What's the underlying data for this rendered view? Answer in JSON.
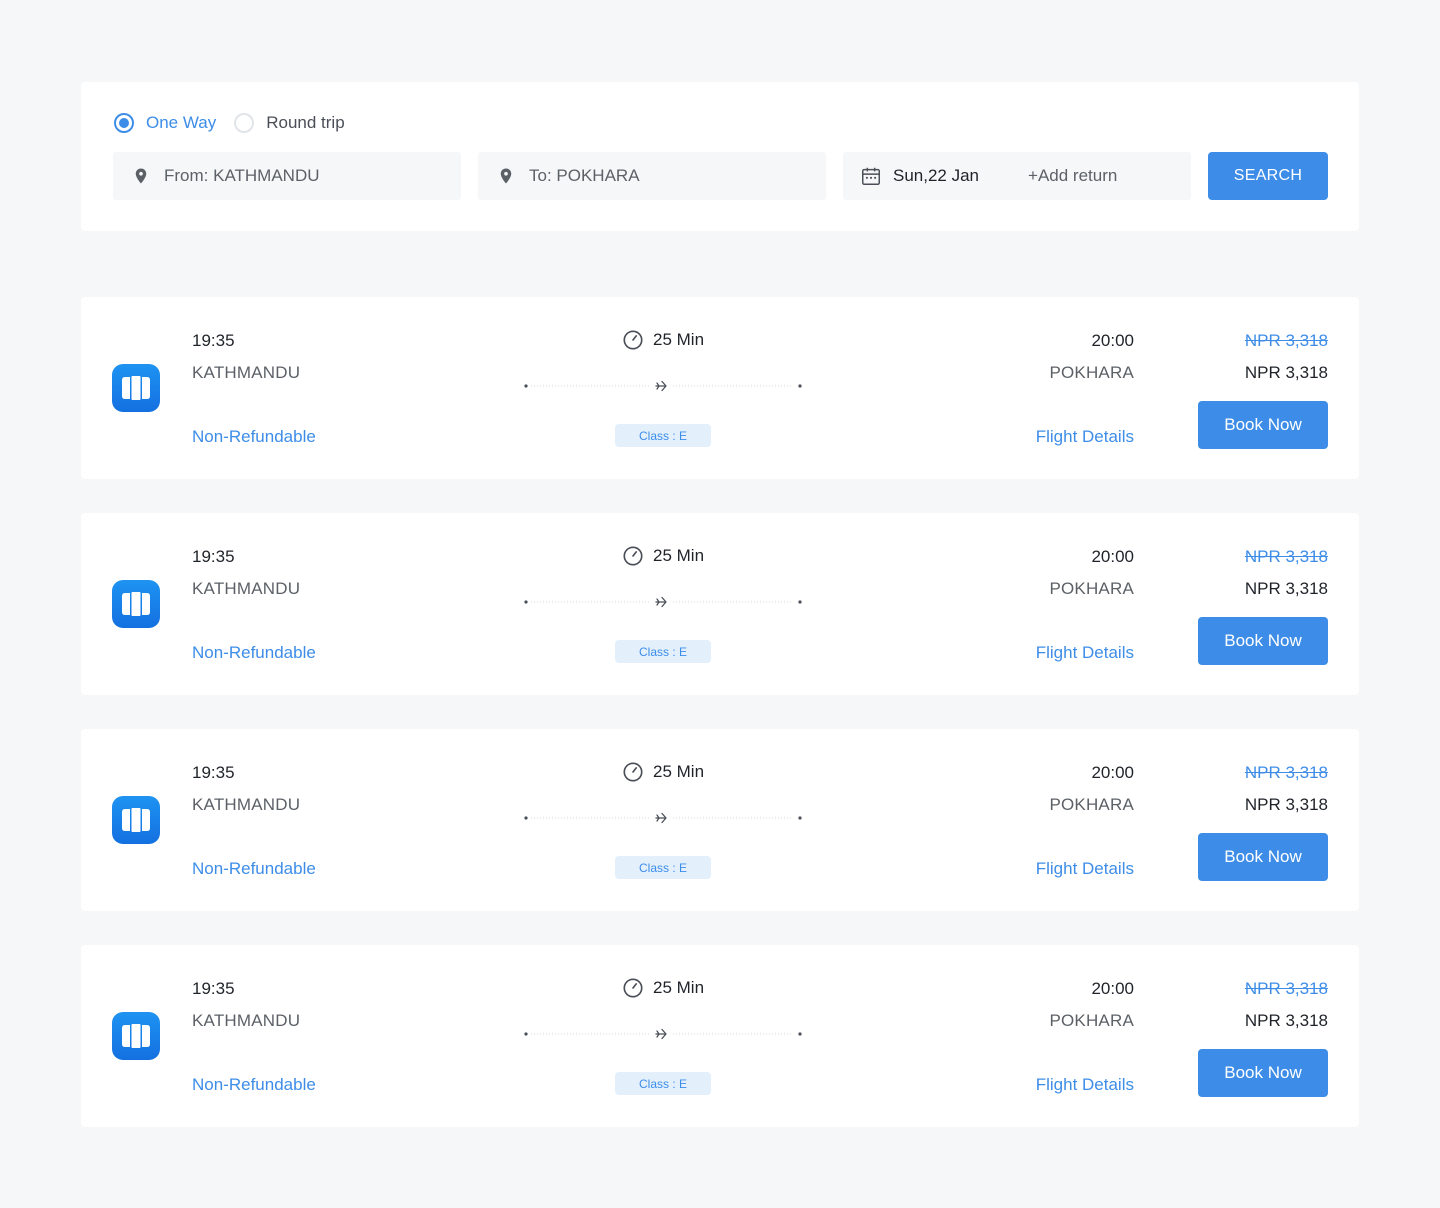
{
  "search": {
    "trip_types": [
      {
        "label": "One Way",
        "selected": true
      },
      {
        "label": "Round trip",
        "selected": false
      }
    ],
    "from": "From: KATHMANDU",
    "to": "To: POKHARA",
    "date": "Sun,22 Jan",
    "add_return": "+Add return",
    "search_label": "SEARCH"
  },
  "flights": [
    {
      "airline_icon": "airline-logo-icon",
      "departure_time": "19:35",
      "departure_city": "KATHMANDU",
      "refund_policy": "Non-Refundable",
      "duration": "25 Min",
      "class_label": "Class : E",
      "arrival_time": "20:00",
      "arrival_city": "POKHARA",
      "details_label": "Flight Details",
      "original_price": "NPR 3,318",
      "price": "NPR 3,318",
      "book_label": "Book Now"
    },
    {
      "airline_icon": "airline-logo-icon",
      "departure_time": "19:35",
      "departure_city": "KATHMANDU",
      "refund_policy": "Non-Refundable",
      "duration": "25 Min",
      "class_label": "Class : E",
      "arrival_time": "20:00",
      "arrival_city": "POKHARA",
      "details_label": "Flight Details",
      "original_price": "NPR 3,318",
      "price": "NPR 3,318",
      "book_label": "Book Now"
    },
    {
      "airline_icon": "airline-logo-icon",
      "departure_time": "19:35",
      "departure_city": "KATHMANDU",
      "refund_policy": "Non-Refundable",
      "duration": "25 Min",
      "class_label": "Class : E",
      "arrival_time": "20:00",
      "arrival_city": "POKHARA",
      "details_label": "Flight Details",
      "original_price": "NPR 3,318",
      "price": "NPR 3,318",
      "book_label": "Book Now"
    },
    {
      "airline_icon": "airline-logo-icon",
      "departure_time": "19:35",
      "departure_city": "KATHMANDU",
      "refund_policy": "Non-Refundable",
      "duration": "25 Min",
      "class_label": "Class : E",
      "arrival_time": "20:00",
      "arrival_city": "POKHARA",
      "details_label": "Flight Details",
      "original_price": "NPR 3,318",
      "price": "NPR 3,318",
      "book_label": "Book Now"
    }
  ],
  "colors": {
    "accent": "#3d8de8",
    "page_bg": "#f6f7f9",
    "card_bg": "#ffffff",
    "badge_bg": "#e3f0fc"
  }
}
